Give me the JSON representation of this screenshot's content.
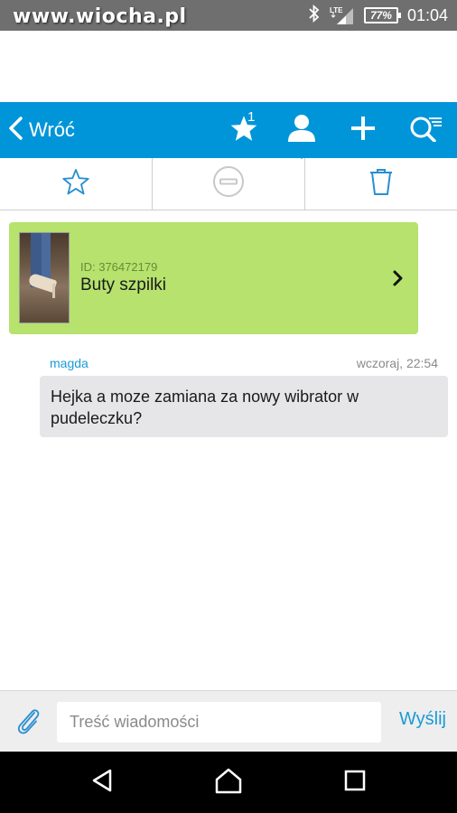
{
  "statusbar": {
    "watermark": "www.wiocha.pl",
    "battery": "77%",
    "time": "01:04",
    "network": "LTE"
  },
  "appbar": {
    "back_label": "Wróć",
    "favorites_count": "1",
    "active_tab": "profile",
    "background_color": "#0095d9",
    "icons": [
      "star-icon",
      "person-icon",
      "plus-icon",
      "search-filter-icon"
    ]
  },
  "actions": {
    "icons": [
      "star-outline-icon",
      "block-icon",
      "trash-icon"
    ]
  },
  "product": {
    "id_text": "ID: 376472179",
    "name": "Buty szpilki",
    "background_color": "#b6e26d"
  },
  "message": {
    "author": "magda",
    "time": "wczoraj, 22:54",
    "text": "Hejka a moze zamiana za nowy wibrator w pudeleczku?"
  },
  "compose": {
    "placeholder": "Treść wiadomości",
    "value": "",
    "send_label": "Wyślij"
  },
  "navbar": {
    "icons": [
      "back-triangle-icon",
      "home-icon",
      "recents-icon"
    ]
  }
}
